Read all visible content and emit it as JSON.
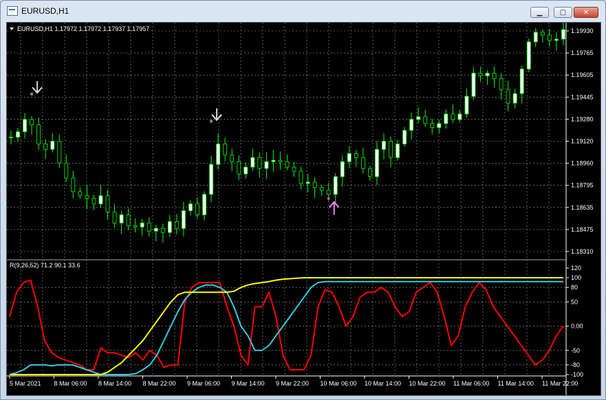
{
  "window": {
    "title": "EURUSD,H1",
    "min_glyph": "▁",
    "max_glyph": "▢",
    "close_glyph": "✕"
  },
  "chart": {
    "info_line": "EURUSD,H1  1.17972 1.17972 1.17937 1.17957",
    "price_axis": [
      "1.19930",
      "1.19765",
      "1.19605",
      "1.19445",
      "1.19280",
      "1.19120",
      "1.18960",
      "1.18795",
      "1.18635",
      "1.18475",
      "1.18310"
    ],
    "indicator_label": "R(9,26,52) 71.2 90.1 33.6",
    "indicator_axis": [
      "120",
      "100",
      "80",
      "50",
      "0.00",
      "-50",
      "-80",
      "-100"
    ],
    "time_axis": [
      "5 Mar 2021",
      "8 Mar 06:00",
      "8 Mar 14:00",
      "8 Mar 22:00",
      "9 Mar 06:00",
      "9 Mar 14:00",
      "9 Mar 22:00",
      "10 Mar 06:00",
      "10 Mar 14:00",
      "10 Mar 22:00",
      "11 Mar 06:00",
      "11 Mar 14:00",
      "11 Mar 22:00"
    ],
    "colors": {
      "background": "#000000",
      "bull": "#ffffff",
      "bear": "#000000",
      "wick": "#00ff00",
      "grid": "#a0a0a0",
      "red_line": "#ff0000",
      "cyan_line": "#33ccdd",
      "yellow_line": "#ffff00",
      "arrow_down": "#d8d8d8",
      "arrow_up": "#ee82ee"
    }
  },
  "chart_data": {
    "type": "line",
    "title": "",
    "price_range": [
      1.1831,
      1.1993
    ],
    "indicator_range": [
      -100,
      120
    ],
    "price_path": [
      1.1915,
      1.1919,
      1.1928,
      1.1924,
      1.191,
      1.1906,
      1.1912,
      1.1896,
      1.1885,
      1.1875,
      1.1872,
      1.187,
      1.1866,
      1.1872,
      1.186,
      1.1852,
      1.1858,
      1.185,
      1.1849,
      1.1852,
      1.1846,
      1.1848,
      1.1845,
      1.1853,
      1.1848,
      1.1861,
      1.1866,
      1.1858,
      1.1873,
      1.1895,
      1.191,
      1.1902,
      1.1897,
      1.1888,
      1.1893,
      1.19,
      1.1892,
      1.1897,
      1.1898,
      1.1897,
      1.1893,
      1.189,
      1.1881,
      1.1882,
      1.1878,
      1.1876,
      1.1873,
      1.1886,
      1.1897,
      1.1903,
      1.19,
      1.1892,
      1.1886,
      1.1906,
      1.1912,
      1.19,
      1.191,
      1.192,
      1.1928,
      1.193,
      1.1925,
      1.1922,
      1.1925,
      1.1932,
      1.1928,
      1.1932,
      1.1945,
      1.1962,
      1.196,
      1.1962,
      1.1958,
      1.195,
      1.194,
      1.1947,
      1.1965,
      1.1985,
      1.1992,
      1.199,
      1.1986,
      1.1987,
      1.1994
    ],
    "series": [
      {
        "name": "",
        "color": "#ff0000",
        "values": [
          20,
          70,
          90,
          95,
          40,
          -30,
          -55,
          -65,
          -70,
          -75,
          -80,
          -90,
          -90,
          -45,
          -55,
          -55,
          -60,
          -65,
          -55,
          -70,
          -50,
          -60,
          -85,
          -80,
          -80,
          50,
          80,
          90,
          90,
          90,
          90,
          40,
          0,
          -60,
          -80,
          40,
          40,
          70,
          20,
          -60,
          -90,
          -90,
          -90,
          -60,
          40,
          75,
          70,
          40,
          0,
          20,
          60,
          70,
          70,
          80,
          70,
          40,
          20,
          30,
          70,
          80,
          90,
          70,
          20,
          -40,
          -20,
          40,
          70,
          90,
          75,
          40,
          20,
          0,
          -20,
          -40,
          -60,
          -80,
          -70,
          -50,
          -20,
          0
        ]
      },
      {
        "name": "",
        "color": "#33ccdd",
        "values": [
          -100,
          -96,
          -90,
          -80,
          -80,
          -80,
          -82,
          -80,
          -80,
          -80,
          -85,
          -90,
          -95,
          -100,
          -100,
          -100,
          -100,
          -100,
          -98,
          -90,
          -80,
          -60,
          -30,
          0,
          30,
          55,
          70,
          80,
          85,
          85,
          80,
          70,
          40,
          0,
          -20,
          -50,
          -50,
          -40,
          -20,
          0,
          20,
          40,
          60,
          80,
          90,
          92,
          92,
          92,
          92,
          92,
          92,
          92,
          92,
          92,
          92,
          92,
          92,
          92,
          92,
          92,
          92,
          92,
          92,
          92,
          92,
          92,
          92,
          92,
          92,
          92,
          92,
          92,
          92,
          92,
          92,
          92,
          92,
          92,
          92,
          92
        ]
      },
      {
        "name": "",
        "color": "#ffff00",
        "values": [
          -100,
          -100,
          -100,
          -100,
          -100,
          -100,
          -100,
          -100,
          -100,
          -100,
          -100,
          -100,
          -100,
          -100,
          -95,
          -85,
          -75,
          -60,
          -45,
          -30,
          -10,
          10,
          30,
          50,
          65,
          70,
          70,
          70,
          70,
          70,
          70,
          70,
          72,
          80,
          85,
          88,
          90,
          92,
          95,
          97,
          98,
          99,
          100,
          100,
          100,
          100,
          100,
          100,
          100,
          100,
          100,
          100,
          100,
          100,
          100,
          100,
          100,
          100,
          100,
          100,
          100,
          100,
          100,
          100,
          100,
          100,
          100,
          100,
          100,
          100,
          100,
          100,
          100,
          100,
          100,
          100,
          100,
          100,
          100,
          100
        ]
      }
    ],
    "arrows": [
      {
        "type": "down",
        "price": 1.1942,
        "index": 3
      },
      {
        "type": "down",
        "price": 1.1922,
        "index": 29
      },
      {
        "type": "up",
        "price": 1.1874,
        "index": 46
      }
    ]
  }
}
